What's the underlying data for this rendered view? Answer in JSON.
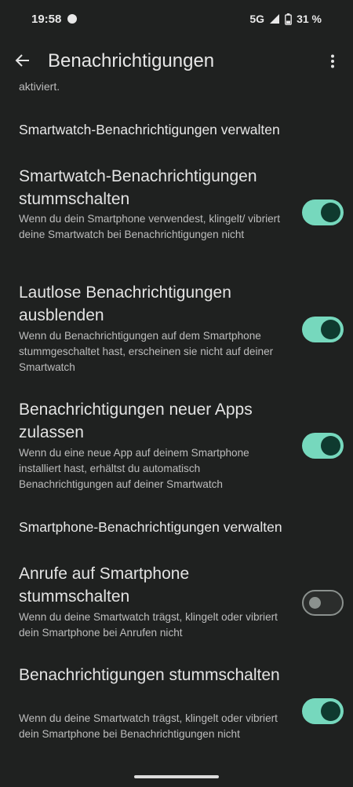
{
  "status_bar": {
    "time": "19:58",
    "network": "5G",
    "battery": "31 %"
  },
  "app_bar": {
    "title": "Benachrichtigungen"
  },
  "truncated_text": "aktiviert.",
  "sections": {
    "smartwatch_header": "Smartwatch-Benachrichtigungen verwalten",
    "smartphone_header": "Smartphone-Benachrichtigungen verwalten"
  },
  "settings": [
    {
      "title": "Smartwatch-Benachrichtigungen stummschalten",
      "description": "Wenn du dein Smartphone verwendest, klingelt/ vibriert deine Smartwatch bei Benachrichtigungen nicht",
      "enabled": true
    },
    {
      "title": "Lautlose Benachrichtigungen ausblenden",
      "description": "Wenn du Benachrichtigungen auf dem Smartphone stummgeschaltet hast, erscheinen sie nicht auf deiner Smartwatch",
      "enabled": true
    },
    {
      "title": "Benachrichtigungen neuer Apps zulassen",
      "description": "Wenn du eine neue App auf deinem Smartphone installiert hast, erhältst du automatisch Benachrichtigungen auf deiner Smartwatch",
      "enabled": true
    },
    {
      "title": "Anrufe auf Smartphone stummschalten",
      "description": "Wenn du deine Smartwatch trägst, klingelt oder vibriert dein Smartphone bei Anrufen nicht",
      "enabled": false
    },
    {
      "title": "Benachrichtigungen stummschalten",
      "description": "Wenn du deine Smartwatch trägst, klingelt oder vibriert dein Smartphone bei Benachrichtigungen nicht",
      "enabled": true
    }
  ],
  "colors": {
    "background": "#1f2120",
    "toggle_on": "#76d8bd",
    "toggle_knob_on": "#0f3a2f",
    "toggle_off_outline": "#8b918e"
  }
}
